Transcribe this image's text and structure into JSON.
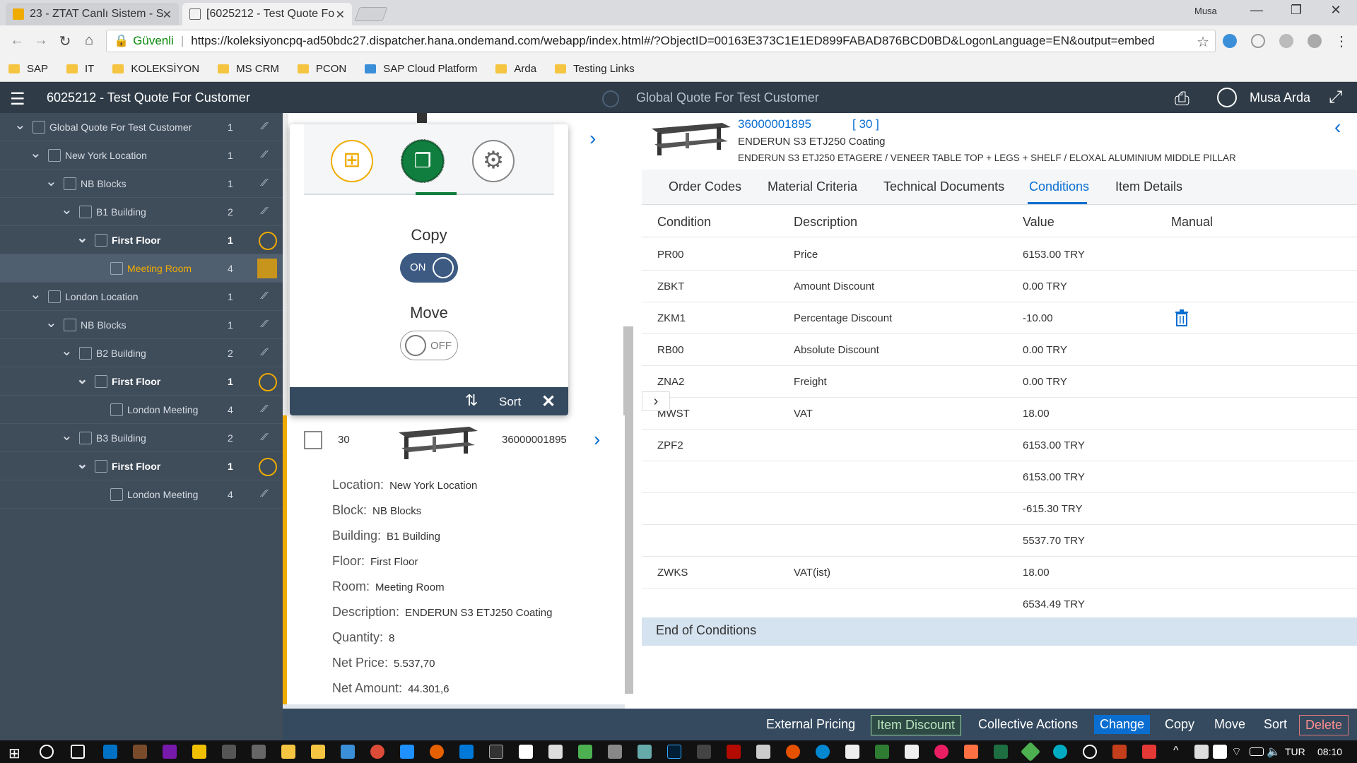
{
  "browser": {
    "tabs": [
      {
        "title": "23 - ZTAT Canlı Sistem - S"
      },
      {
        "title": "[6025212 - Test Quote Fo"
      }
    ],
    "window_user": "Musa",
    "address": {
      "secure_label": "Güvenli",
      "url": "https://koleksiyoncpq-ad50bdc27.dispatcher.hana.ondemand.com/webapp/index.html#/?ObjectID=00163E373C1E1ED899FABAD876BCD0BD&LogonLanguage=EN&output=embed"
    },
    "bookmarks": [
      "SAP",
      "IT",
      "KOLEKSİYON",
      "MS CRM",
      "PCON",
      "SAP Cloud Platform",
      "Arda",
      "Testing Links"
    ]
  },
  "header": {
    "title": "6025212 - Test Quote For Customer",
    "center_title": "Global Quote For Test Customer",
    "user": "Musa Arda"
  },
  "tree": [
    {
      "label": "Global Quote For Test Customer",
      "count": "1",
      "indent": 0,
      "state": "expanded"
    },
    {
      "label": "New York Location",
      "count": "1",
      "indent": 1,
      "state": "expanded"
    },
    {
      "label": "NB Blocks",
      "count": "1",
      "indent": 2,
      "state": "expanded"
    },
    {
      "label": "B1 Building",
      "count": "2",
      "indent": 3,
      "state": "expanded"
    },
    {
      "label": "First Floor",
      "count": "1",
      "indent": 4,
      "state": "floor"
    },
    {
      "label": "Meeting Room",
      "count": "4",
      "indent": 5,
      "state": "selected"
    },
    {
      "label": "London Location",
      "count": "1",
      "indent": 1,
      "state": "expanded"
    },
    {
      "label": "NB Blocks",
      "count": "1",
      "indent": 2,
      "state": "expanded"
    },
    {
      "label": "B2 Building",
      "count": "2",
      "indent": 3,
      "state": "expanded"
    },
    {
      "label": "First Floor",
      "count": "1",
      "indent": 4,
      "state": "floor"
    },
    {
      "label": "London Meeting",
      "count": "4",
      "indent": 5,
      "state": "leaf"
    },
    {
      "label": "B3 Building",
      "count": "2",
      "indent": 3,
      "state": "expanded"
    },
    {
      "label": "First Floor",
      "count": "1",
      "indent": 4,
      "state": "floor"
    },
    {
      "label": "London Meeting",
      "count": "4",
      "indent": 5,
      "state": "leaf"
    }
  ],
  "popover": {
    "copy_label": "Copy",
    "copy_state": "ON",
    "move_label": "Move",
    "move_state": "OFF",
    "sort_label": "Sort"
  },
  "item": {
    "position": "30",
    "number": "36000001895",
    "fields": [
      {
        "label": "Location:",
        "value": "New York Location"
      },
      {
        "label": "Block:",
        "value": "NB Blocks"
      },
      {
        "label": "Building:",
        "value": "B1 Building"
      },
      {
        "label": "Floor:",
        "value": "First Floor"
      },
      {
        "label": "Room:",
        "value": "Meeting Room"
      },
      {
        "label": "Description:",
        "value": "ENDERUN S3 ETJ250 Coating"
      },
      {
        "label": "Quantity:",
        "value": "8"
      },
      {
        "label": "Net Price:",
        "value": "5.537,70"
      },
      {
        "label": "Net Amount:",
        "value": "44.301,6"
      }
    ]
  },
  "detail": {
    "number": "36000001895",
    "position": "[ 30 ]",
    "description": "ENDERUN S3 ETJ250 Coating",
    "long_description": "ENDERUN S3 ETJ250 ETAGERE / VENEER TABLE TOP + LEGS + SHELF / ELOXAL ALUMINIUM MIDDLE PILLAR",
    "tabs": [
      "Order Codes",
      "Material Criteria",
      "Technical Documents",
      "Conditions",
      "Item Details"
    ],
    "active_tab": "Conditions",
    "columns": [
      "Condition",
      "Description",
      "Value",
      "Manual"
    ],
    "conditions": [
      {
        "code": "PR00",
        "desc": "Price",
        "value": "6153.00 TRY"
      },
      {
        "code": "ZBKT",
        "desc": "Amount Discount",
        "value": "0.00 TRY"
      },
      {
        "code": "ZKM1",
        "desc": "Percentage Discount",
        "value": "-10.00",
        "manual": true
      },
      {
        "code": "RB00",
        "desc": "Absolute Discount",
        "value": "0.00 TRY"
      },
      {
        "code": "ZNA2",
        "desc": "Freight",
        "value": "0.00 TRY"
      },
      {
        "code": "MWST",
        "desc": "VAT",
        "value": "18.00"
      },
      {
        "code": "ZPF2",
        "desc": "",
        "value": "6153.00 TRY"
      },
      {
        "code": "",
        "desc": "",
        "value": "6153.00 TRY"
      },
      {
        "code": "",
        "desc": "",
        "value": "-615.30 TRY"
      },
      {
        "code": "",
        "desc": "",
        "value": "5537.70 TRY"
      },
      {
        "code": "ZWKS",
        "desc": "VAT(ist)",
        "value": "18.00"
      },
      {
        "code": "",
        "desc": "",
        "value": "6534.49 TRY"
      }
    ],
    "end_label": "End of Conditions"
  },
  "actions": [
    "External Pricing",
    "Item Discount",
    "Collective Actions",
    "Change",
    "Copy",
    "Move",
    "Sort",
    "Delete"
  ],
  "taskbar": {
    "lang": "TUR",
    "time": "08:10"
  }
}
